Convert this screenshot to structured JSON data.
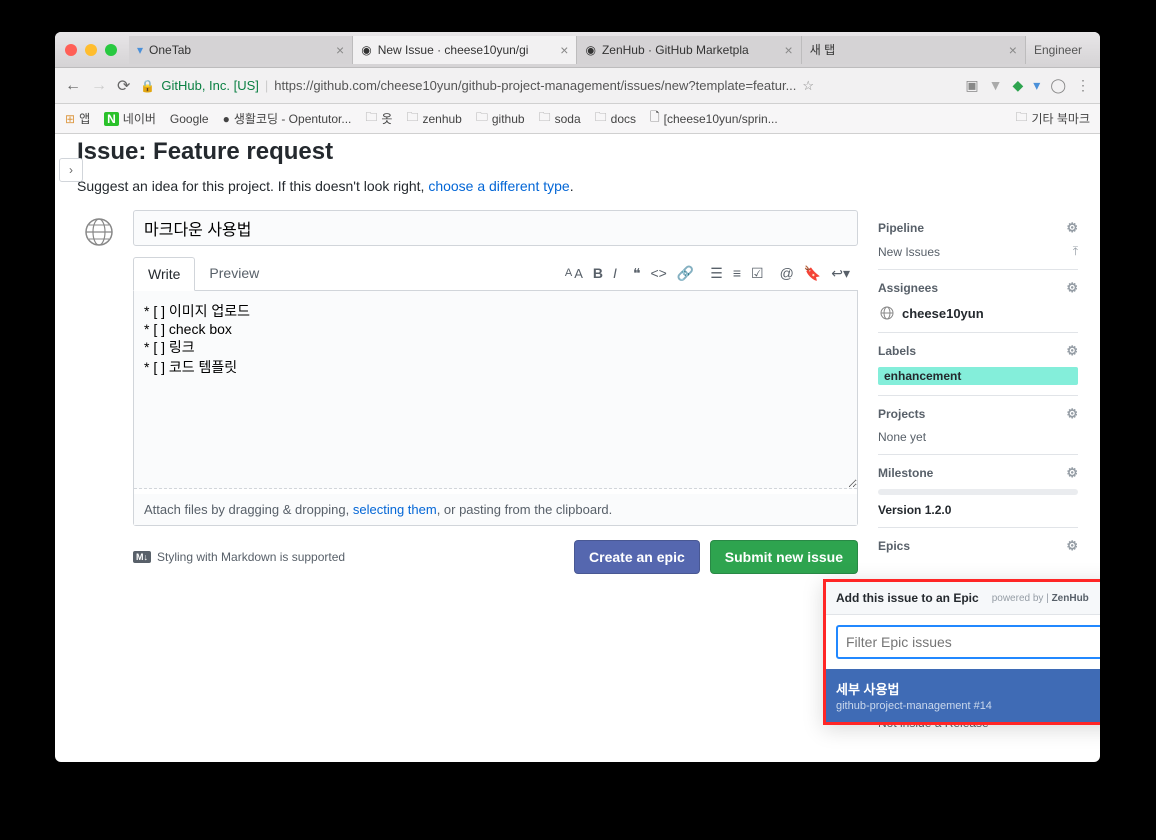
{
  "browser": {
    "tabs": [
      {
        "title": "OneTab",
        "active": false
      },
      {
        "title": "New Issue · cheese10yun/gi",
        "active": true
      },
      {
        "title": "ZenHub · GitHub Marketpla",
        "active": false
      },
      {
        "title": "새 탭",
        "active": false
      }
    ],
    "profile": "Engineer",
    "secure_name": "GitHub, Inc. [US]",
    "url": "https://github.com/cheese10yun/github-project-management/issues/new?template=featur...",
    "bookmarks": {
      "apps": "앱",
      "naver": "네이버",
      "google": "Google",
      "coding": "생활코딩 - Opentutor...",
      "folders": [
        "옷",
        "zenhub",
        "github",
        "soda",
        "docs"
      ],
      "link": "[cheese10yun/sprin...",
      "other": "기타 북마크"
    }
  },
  "page": {
    "heading": "Issue: Feature request",
    "subtitle_pre": "Suggest an idea for this project. If this doesn't look right, ",
    "subtitle_link": "choose a different type",
    "issue_title": "마크다운 사용법",
    "tabs": {
      "write": "Write",
      "preview": "Preview"
    },
    "body": "* [ ] 이미지 업로드\n* [ ] check box\n* [ ] 링크\n* [ ] 코드 템플릿",
    "attach_pre": "Attach files by dragging & dropping, ",
    "attach_link": "selecting them",
    "attach_post": ", or pasting from the clipboard.",
    "md_info": "Styling with Markdown is supported",
    "md_badge": "M↓",
    "btn_epic": "Create an epic",
    "btn_submit": "Submit new issue"
  },
  "sidebar": {
    "pipeline": {
      "title": "Pipeline",
      "value": "New Issues"
    },
    "assignees": {
      "title": "Assignees",
      "user": "cheese10yun"
    },
    "labels": {
      "title": "Labels",
      "value": "enhancement"
    },
    "projects": {
      "title": "Projects",
      "value": "None yet"
    },
    "milestone": {
      "title": "Milestone",
      "value": "Version 1.2.0"
    },
    "epics": {
      "title": "Epics"
    },
    "release": "Not inside a Release"
  },
  "epic_popup": {
    "heading": "Add this issue to an Epic",
    "powered_pre": "powered by | ",
    "powered_name": "ZenHub",
    "placeholder": "Filter Epic issues",
    "item_title": "세부 사용법",
    "item_sub": "github-project-management #14"
  }
}
